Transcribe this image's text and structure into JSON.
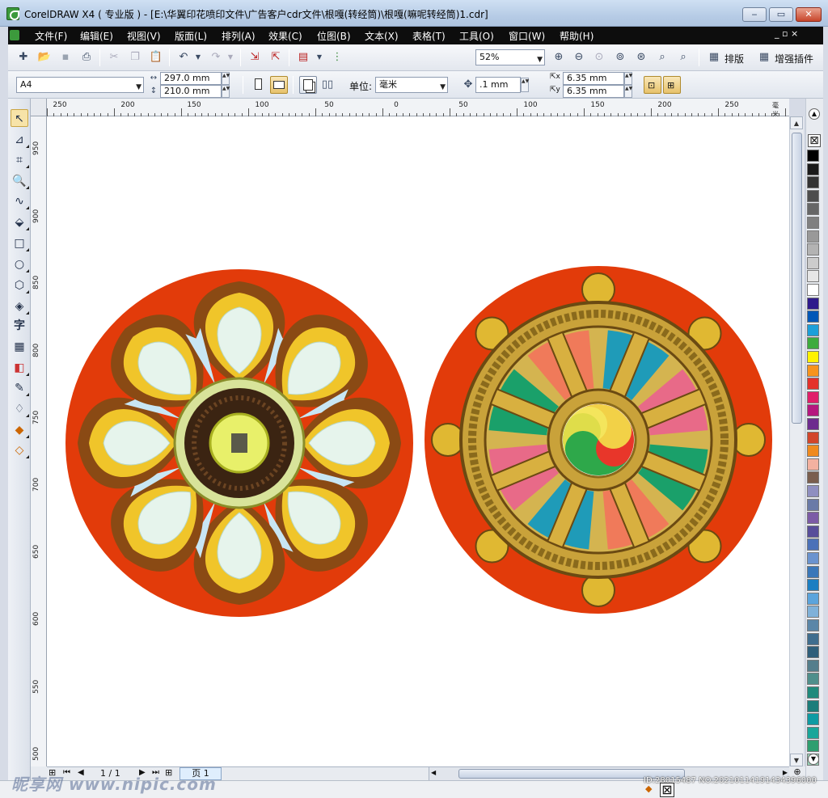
{
  "window": {
    "title": "CorelDRAW X4 ( 专业版 ) - [E:\\华翼印花喷印文件\\广告客户cdr文件\\根嘎(转经筒)\\根嘎(嘛呢转经筒)1.cdr]",
    "min_label": "‒",
    "max_label": "▭",
    "close_label": "✕",
    "doc_controls": "_ ▫ ×"
  },
  "menu": {
    "items": [
      "文件(F)",
      "编辑(E)",
      "视图(V)",
      "版面(L)",
      "排列(A)",
      "效果(C)",
      "位图(B)",
      "文本(X)",
      "表格(T)",
      "工具(O)",
      "窗口(W)",
      "帮助(H)"
    ]
  },
  "toolbar": {
    "zoom": "52%",
    "layout_label": "排版",
    "plugin_label": "增强插件",
    "icons": [
      "new-icon",
      "open-icon",
      "save-icon",
      "print-icon",
      "cut-icon",
      "copy-icon",
      "paste-icon",
      "undo-icon",
      "redo-icon",
      "import-icon",
      "export-icon",
      "publish-icon",
      "application-launcher-icon"
    ]
  },
  "property_bar": {
    "page_size": "A4",
    "width": "297.0 mm",
    "height": "210.0 mm",
    "units_label": "单位:",
    "units_value": "毫米",
    "nudge": ".1 mm",
    "dup_x": "6.35 mm",
    "dup_y": "6.35 mm"
  },
  "rulers": {
    "h_labels": [
      "250",
      "200",
      "150",
      "100",
      "50",
      "0",
      "50",
      "100",
      "150",
      "200",
      "250",
      "毫米"
    ],
    "v_labels": [
      "950",
      "900",
      "850",
      "800",
      "750",
      "700",
      "650",
      "600",
      "550",
      "500"
    ]
  },
  "toolbox": {
    "text_tool": "字"
  },
  "pager": {
    "page_count": "1 / 1",
    "page_tab": "页 1"
  },
  "colors": {
    "ornament_bg": "#e23b0a",
    "palette": [
      "#000000",
      "#1a1a1a",
      "#333333",
      "#4d4d4d",
      "#666666",
      "#808080",
      "#999999",
      "#b3b3b3",
      "#cccccc",
      "#e6e6e6",
      "#ffffff",
      "#2e1a8c",
      "#0057b7",
      "#1c9fd9",
      "#3dab3d",
      "#fff200",
      "#f7941d",
      "#e4312b",
      "#e01e6a",
      "#b5177f",
      "#6d2b8e",
      "#d2452a",
      "#ef8a1e",
      "#f3b1a0",
      "#7a5e4e",
      "#8f8fc0",
      "#6a7aa7",
      "#7c5ba6",
      "#584e9a",
      "#4b71b8",
      "#6a93cf",
      "#3a77b9",
      "#1b7ec2",
      "#5ba4dc",
      "#7fb1d9",
      "#5a86a8",
      "#3f6d8e",
      "#2e5e7a",
      "#547e8c",
      "#4f8f8c",
      "#1f8a7c",
      "#1c7d7a",
      "#0f9ba3",
      "#1aa69a",
      "#2e9e6f",
      "#97d3b7"
    ]
  },
  "watermark": {
    "left": "昵享网 www.nipic.com",
    "right": "ID:28015487 NO:20210114191434396000"
  }
}
